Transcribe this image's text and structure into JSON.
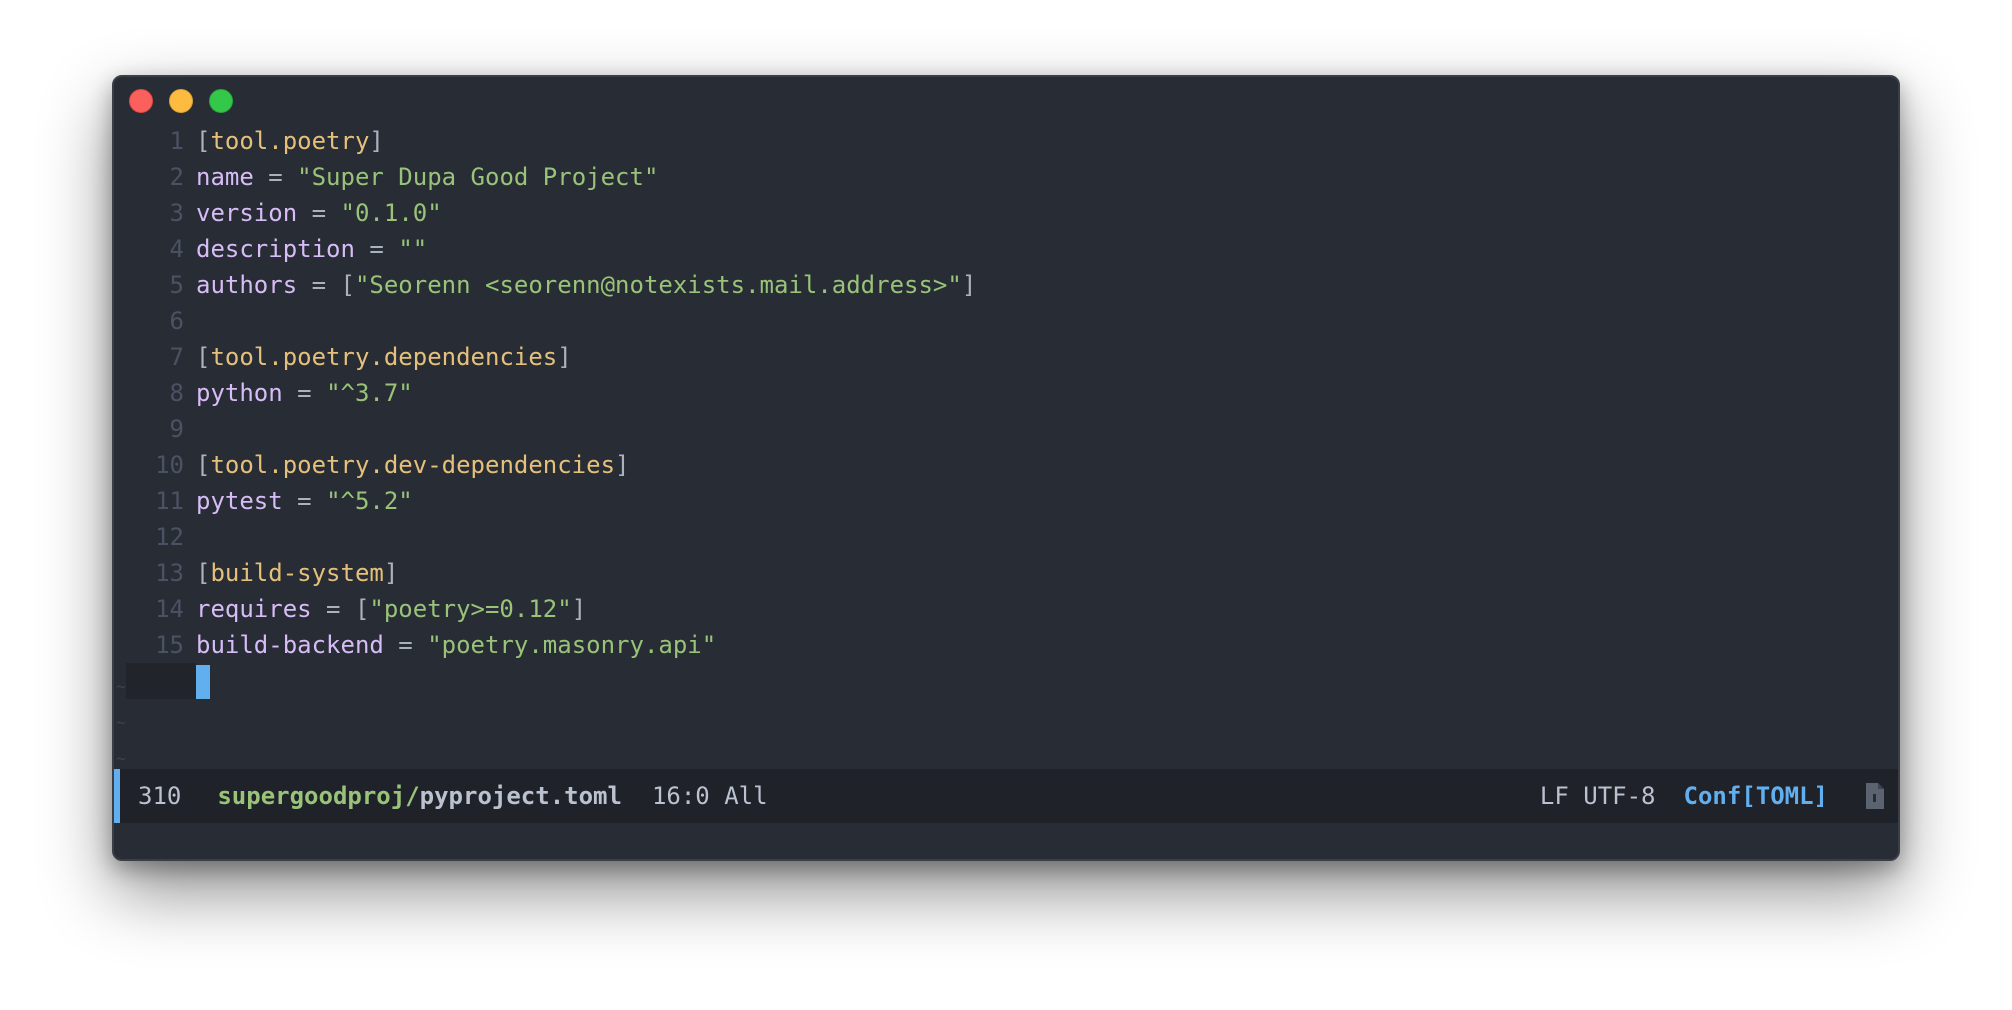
{
  "window": {
    "traffic_lights": [
      "close",
      "minimize",
      "maximize"
    ]
  },
  "editor": {
    "lines": [
      {
        "num": "1",
        "parts": [
          [
            "bracket",
            "["
          ],
          [
            "key",
            "tool.poetry"
          ],
          [
            "bracket",
            "]"
          ]
        ]
      },
      {
        "num": "2",
        "parts": [
          [
            "name",
            "name"
          ],
          [
            "op",
            " = "
          ],
          [
            "str",
            "\"Super Dupa Good Project\""
          ]
        ]
      },
      {
        "num": "3",
        "parts": [
          [
            "name",
            "version"
          ],
          [
            "op",
            " = "
          ],
          [
            "str",
            "\"0.1.0\""
          ]
        ]
      },
      {
        "num": "4",
        "parts": [
          [
            "name",
            "description"
          ],
          [
            "op",
            " = "
          ],
          [
            "str",
            "\"\""
          ]
        ]
      },
      {
        "num": "5",
        "parts": [
          [
            "name",
            "authors"
          ],
          [
            "op",
            " = ["
          ],
          [
            "str",
            "\"Seorenn <seorenn@notexists.mail.address>\""
          ],
          [
            "op",
            "]"
          ]
        ]
      },
      {
        "num": "6",
        "parts": []
      },
      {
        "num": "7",
        "parts": [
          [
            "bracket",
            "["
          ],
          [
            "key",
            "tool.poetry.dependencies"
          ],
          [
            "bracket",
            "]"
          ]
        ]
      },
      {
        "num": "8",
        "parts": [
          [
            "name",
            "python"
          ],
          [
            "op",
            " = "
          ],
          [
            "str",
            "\"^3.7\""
          ]
        ]
      },
      {
        "num": "9",
        "parts": []
      },
      {
        "num": "10",
        "parts": [
          [
            "bracket",
            "["
          ],
          [
            "key",
            "tool.poetry.dev-dependencies"
          ],
          [
            "bracket",
            "]"
          ]
        ]
      },
      {
        "num": "11",
        "parts": [
          [
            "name",
            "pytest"
          ],
          [
            "op",
            " = "
          ],
          [
            "str",
            "\"^5.2\""
          ]
        ]
      },
      {
        "num": "12",
        "parts": []
      },
      {
        "num": "13",
        "parts": [
          [
            "bracket",
            "["
          ],
          [
            "key",
            "build-system"
          ],
          [
            "bracket",
            "]"
          ]
        ]
      },
      {
        "num": "14",
        "parts": [
          [
            "name",
            "requires"
          ],
          [
            "op",
            " = ["
          ],
          [
            "str",
            "\"poetry>=0.12\""
          ],
          [
            "op",
            "]"
          ]
        ]
      },
      {
        "num": "15",
        "parts": [
          [
            "name",
            "build-backend"
          ],
          [
            "op",
            " = "
          ],
          [
            "str",
            "\"poetry.masonry.api\""
          ]
        ]
      }
    ],
    "cursor_line": "16"
  },
  "statusbar": {
    "line_count": "310",
    "directory": "supergoodproj/",
    "filename": "pyproject.toml",
    "position": "16:0 All",
    "encoding": "LF UTF-8",
    "mode": "Conf[TOML]",
    "icon": "file-icon"
  },
  "colors": {
    "background": "#282c34",
    "key": "#e5c07b",
    "name": "#d7bcf7",
    "string": "#98c379",
    "accent": "#61afef"
  }
}
